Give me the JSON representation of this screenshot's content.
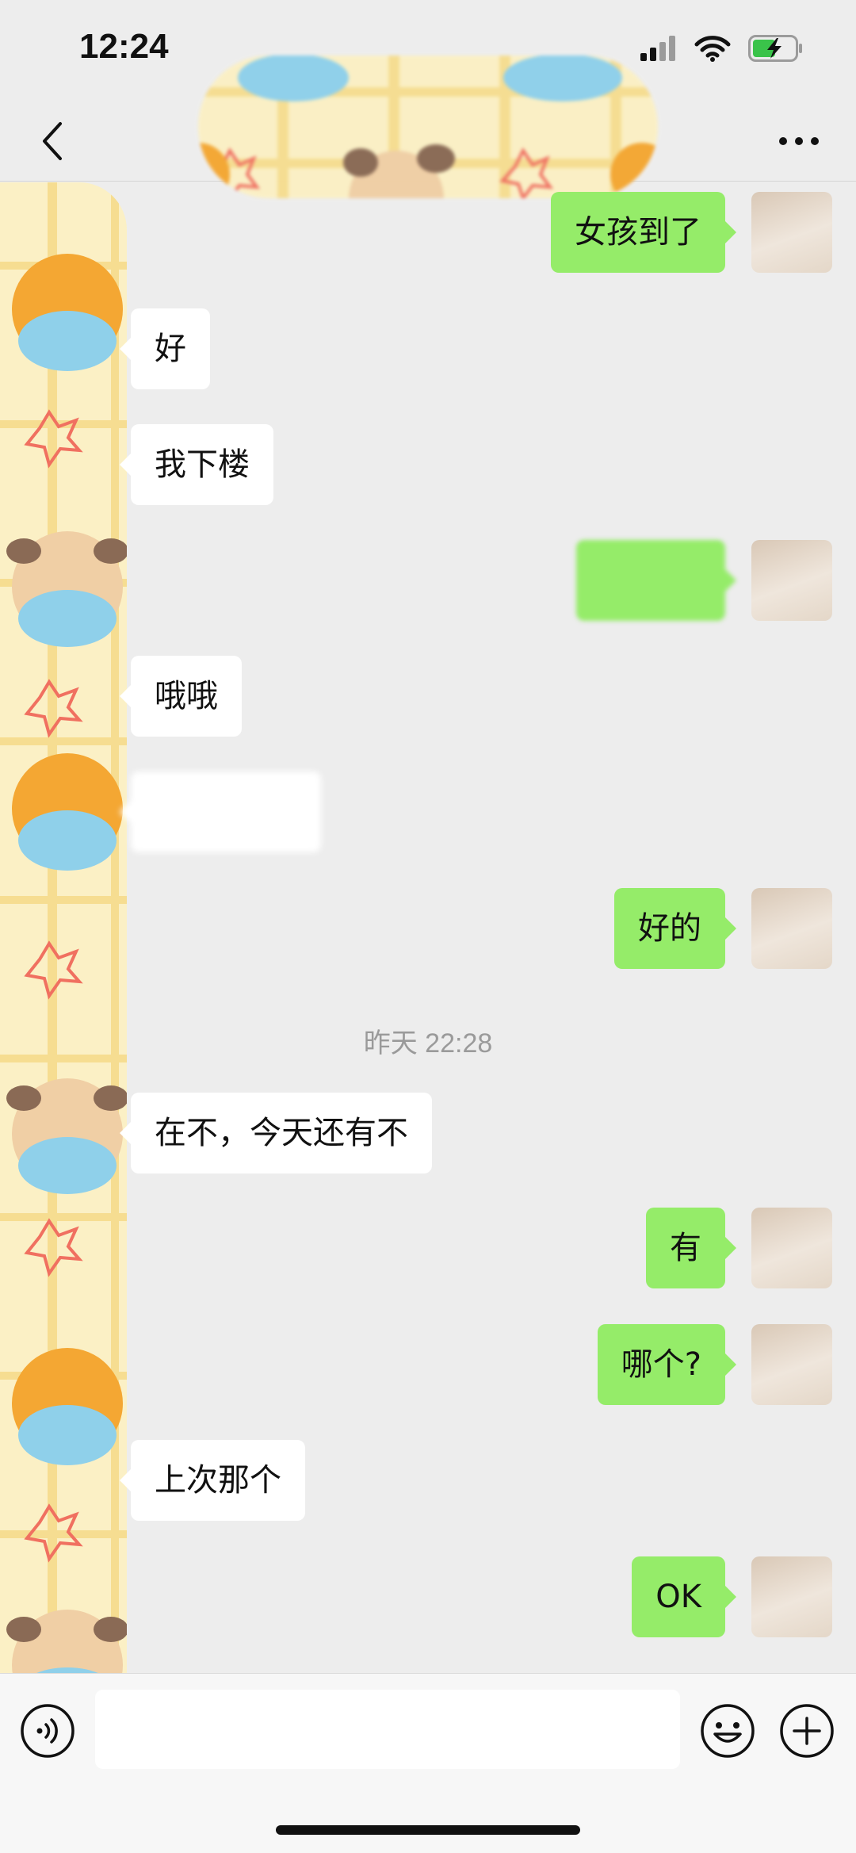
{
  "status_bar": {
    "time": "12:24",
    "battery": "charging"
  },
  "nav": {
    "title": "",
    "back_icon": "chevron-left-icon",
    "more_icon": "ellipsis-icon"
  },
  "time_divider": "昨天 22:28",
  "messages": [
    {
      "side": "out",
      "text": "女孩到了"
    },
    {
      "side": "in",
      "text": "好"
    },
    {
      "side": "in",
      "text": "我下楼"
    },
    {
      "side": "out",
      "text": ""
    },
    {
      "side": "in",
      "text": "哦哦"
    },
    {
      "side": "in",
      "text": ""
    },
    {
      "side": "out",
      "text": "好的"
    },
    {
      "side": "in",
      "text": "在不，今天还有不"
    },
    {
      "side": "out",
      "text": "有"
    },
    {
      "side": "out",
      "text": "哪个?"
    },
    {
      "side": "in",
      "text": "上次那个"
    },
    {
      "side": "out",
      "text": "OK"
    }
  ],
  "input": {
    "placeholder": "",
    "value": ""
  },
  "icons": {
    "voice": "voice-icon",
    "emoji": "emoji-icon",
    "plus": "plus-circle-icon"
  },
  "colors": {
    "outgoing_bubble": "#95ec69",
    "incoming_bubble": "#ffffff",
    "background": "#ededed"
  }
}
